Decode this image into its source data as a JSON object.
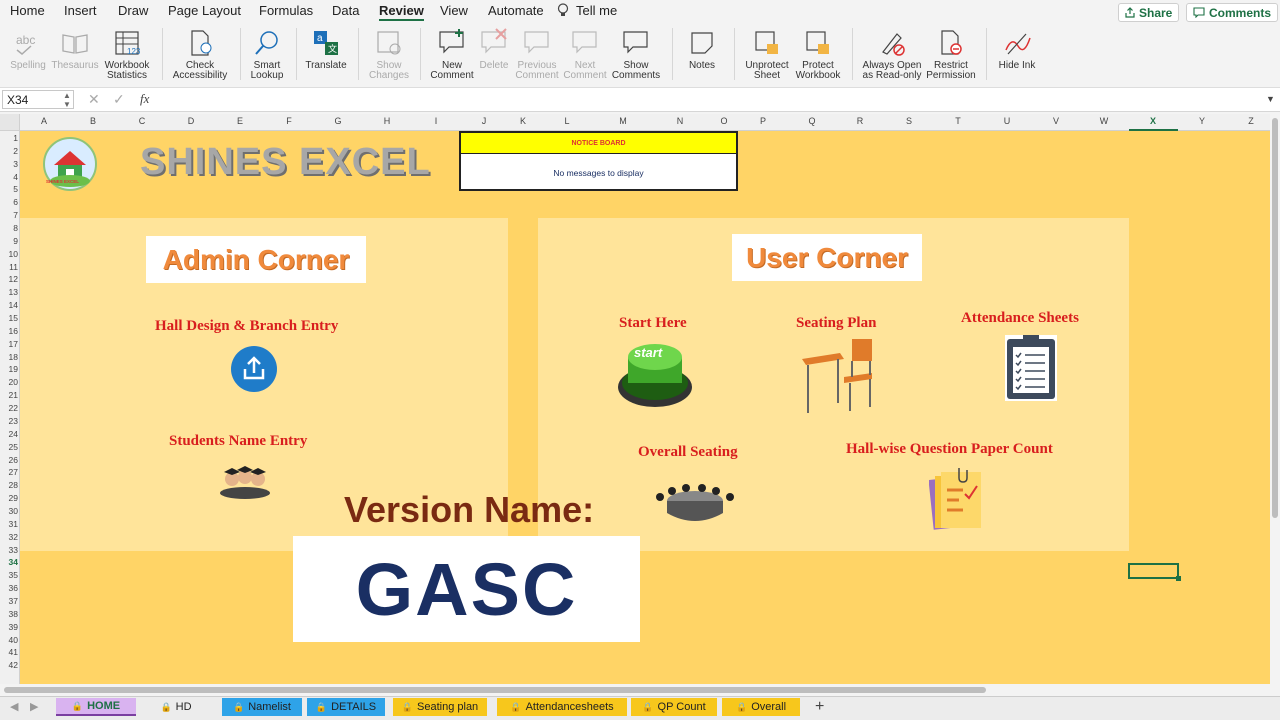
{
  "menu": {
    "tabs": [
      "Home",
      "Insert",
      "Draw",
      "Page Layout",
      "Formulas",
      "Data",
      "Review",
      "View",
      "Automate",
      "Tell me"
    ],
    "active": "Review",
    "share_label": "Share",
    "comments_label": "Comments"
  },
  "ribbon": {
    "spelling": "Spelling",
    "thesaurus": "Thesaurus",
    "workbook_statistics": [
      "Workbook",
      "Statistics"
    ],
    "check_accessibility": [
      "Check",
      "Accessibility"
    ],
    "smart_lookup": [
      "Smart",
      "Lookup"
    ],
    "translate": "Translate",
    "show_changes": [
      "Show",
      "Changes"
    ],
    "new_comment": [
      "New",
      "Comment"
    ],
    "delete": "Delete",
    "previous_comment": [
      "Previous",
      "Comment"
    ],
    "next_comment": [
      "Next",
      "Comment"
    ],
    "show_comments": [
      "Show",
      "Comments"
    ],
    "notes": "Notes",
    "unprotect_sheet": [
      "Unprotect",
      "Sheet"
    ],
    "protect_workbook": [
      "Protect",
      "Workbook"
    ],
    "always_open_readonly": [
      "Always Open",
      "as Read-only"
    ],
    "restrict_permission": [
      "Restrict",
      "Permission"
    ],
    "hide_ink": "Hide Ink"
  },
  "formula_bar": {
    "cell_ref": "X34",
    "fx": "fx",
    "value": ""
  },
  "columns": [
    "A",
    "B",
    "C",
    "D",
    "E",
    "F",
    "G",
    "H",
    "I",
    "J",
    "K",
    "L",
    "M",
    "N",
    "O",
    "P",
    "Q",
    "R",
    "S",
    "T",
    "U",
    "V",
    "W",
    "X",
    "Y",
    "Z"
  ],
  "selected_column": "X",
  "rows_count": 42,
  "selected_row": 34,
  "sheet": {
    "brand_title": "SHINES EXCEL",
    "logo_text": "SHINES EXCEL",
    "notice_board": {
      "title": "NOTICE BOARD",
      "message": "No messages to display"
    },
    "admin_corner": {
      "title": "Admin Corner",
      "items": [
        "Hall Design & Branch Entry",
        "Students Name Entry"
      ]
    },
    "user_corner": {
      "title": "User Corner",
      "items": [
        "Start Here",
        "Seating Plan",
        "Attendance Sheets",
        "Overall Seating",
        "Hall-wise Question Paper Count"
      ]
    },
    "start_button_text": "start",
    "version_label": "Version Name:",
    "version_value": "GASC"
  },
  "sheet_tabs": [
    {
      "label": "HOME",
      "color": "#d9b3f0",
      "locked": true,
      "active": true
    },
    {
      "label": "HD",
      "color": "#ececec",
      "locked": true,
      "active": false
    },
    {
      "label": "Namelist",
      "color": "#2ea3e8",
      "locked": true,
      "active": false
    },
    {
      "label": "DETAILS",
      "color": "#2ea3e8",
      "locked": true,
      "active": false
    },
    {
      "label": "Seating plan",
      "color": "#f7c71c",
      "locked": true,
      "active": false
    },
    {
      "label": "Attendancesheets",
      "color": "#f7c71c",
      "locked": true,
      "active": false
    },
    {
      "label": "QP Count",
      "color": "#f7c71c",
      "locked": true,
      "active": false
    },
    {
      "label": "Overall",
      "color": "#f7c71c",
      "locked": true,
      "active": false
    }
  ],
  "add_sheet": "+",
  "colors": {
    "accent": "#1e7145",
    "sheet_bg": "#ffd466",
    "panel_bg": "#ffe49a",
    "label_red": "#d81e1e",
    "version_brown": "#7a2a12",
    "version_navy": "#1a2f63"
  }
}
